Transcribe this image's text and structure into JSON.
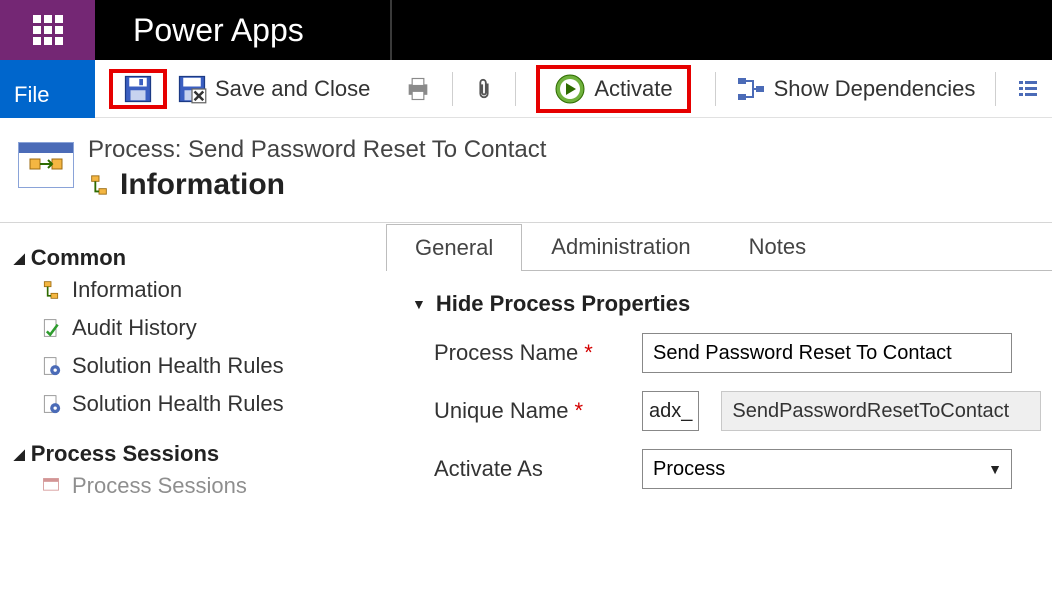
{
  "header": {
    "app_title": "Power Apps",
    "file_label": "File"
  },
  "commands": {
    "save": "Save",
    "save_and_close": "Save and Close",
    "activate": "Activate",
    "show_dependencies": "Show Dependencies"
  },
  "breadcrumb": "Process: Send Password Reset To Contact",
  "page_title": "Information",
  "leftnav": {
    "sections": [
      {
        "title": "Common",
        "items": [
          {
            "label": "Information",
            "icon": "workflow-icon"
          },
          {
            "label": "Audit History",
            "icon": "audit-icon"
          },
          {
            "label": "Solution Health Rules",
            "icon": "health-icon"
          },
          {
            "label": "Solution Health Rules",
            "icon": "health-icon"
          }
        ]
      },
      {
        "title": "Process Sessions",
        "items": [
          {
            "label": "Process Sessions",
            "icon": "sessions-icon"
          }
        ]
      }
    ]
  },
  "tabs": [
    {
      "label": "General",
      "active": true
    },
    {
      "label": "Administration",
      "active": false
    },
    {
      "label": "Notes",
      "active": false
    }
  ],
  "section_toggle": "Hide Process Properties",
  "form": {
    "process_name": {
      "label": "Process Name",
      "required": true,
      "value": "Send Password Reset To Contact"
    },
    "unique_name": {
      "label": "Unique Name",
      "required": true,
      "prefix": "adx_",
      "value": "SendPasswordResetToContact"
    },
    "activate_as": {
      "label": "Activate As",
      "required": false,
      "value": "Process",
      "options": [
        "Process"
      ]
    }
  }
}
